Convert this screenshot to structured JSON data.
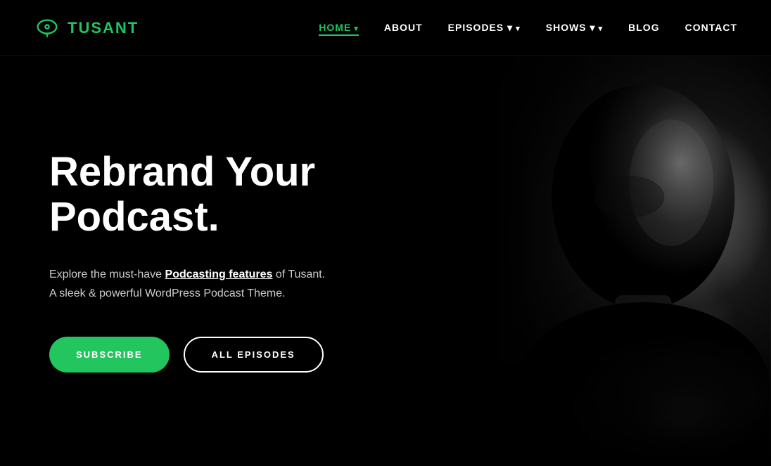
{
  "brand": {
    "name": "TUSANT",
    "icon_label": "podcast-cloud-icon"
  },
  "nav": {
    "links": [
      {
        "label": "HOME",
        "active": true,
        "has_dropdown": true
      },
      {
        "label": "ABOUT",
        "active": false,
        "has_dropdown": false
      },
      {
        "label": "EPISODES",
        "active": false,
        "has_dropdown": true
      },
      {
        "label": "SHOWS",
        "active": false,
        "has_dropdown": true
      },
      {
        "label": "BLOG",
        "active": false,
        "has_dropdown": false
      },
      {
        "label": "CONTACT",
        "active": false,
        "has_dropdown": false
      }
    ]
  },
  "hero": {
    "title": "Rebrand Your Podcast.",
    "description_prefix": "Explore the must-have ",
    "description_link": "Podcasting features",
    "description_suffix": " of Tusant.",
    "description_line2": "A sleek & powerful WordPress Podcast Theme.",
    "btn_subscribe": "SUBSCRIBE",
    "btn_episodes": "ALL EPISODES"
  },
  "colors": {
    "accent": "#22c55e",
    "bg": "#000000",
    "text": "#ffffff",
    "text_muted": "#cccccc"
  }
}
